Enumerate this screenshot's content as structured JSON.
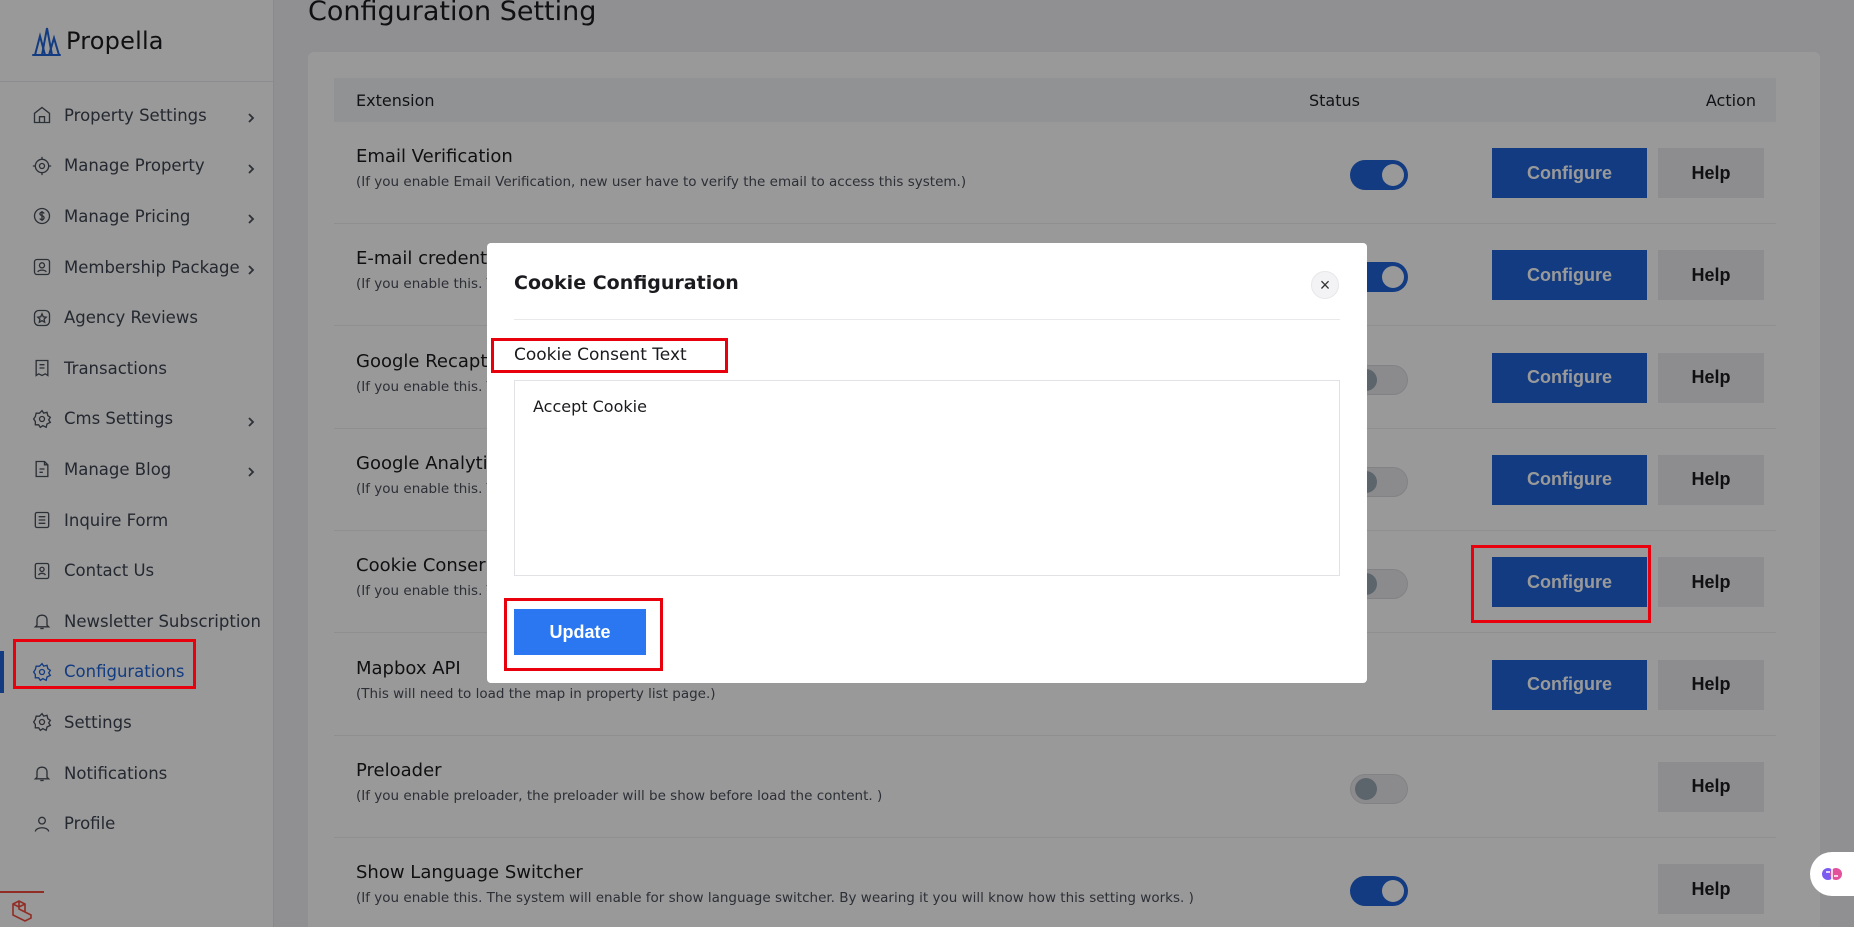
{
  "brand": {
    "name": "Propella"
  },
  "sidebar": {
    "items": [
      {
        "label": "Property Settings",
        "icon": "home-icon",
        "chevron": true
      },
      {
        "label": "Manage Property",
        "icon": "gear-badge-icon",
        "chevron": true
      },
      {
        "label": "Manage Pricing",
        "icon": "dollar-cycle-icon",
        "chevron": true
      },
      {
        "label": "Membership Package",
        "icon": "user-card-icon",
        "chevron": true
      },
      {
        "label": "Agency Reviews",
        "icon": "star-badge-icon",
        "chevron": false
      },
      {
        "label": "Transactions",
        "icon": "receipt-icon",
        "chevron": false
      },
      {
        "label": "Cms Settings",
        "icon": "gear-icon",
        "chevron": true
      },
      {
        "label": "Manage Blog",
        "icon": "edit-doc-icon",
        "chevron": true
      },
      {
        "label": "Inquire Form",
        "icon": "list-doc-icon",
        "chevron": false
      },
      {
        "label": "Contact Us",
        "icon": "contact-icon",
        "chevron": false
      },
      {
        "label": "Newsletter Subscription",
        "icon": "bell-icon",
        "chevron": false
      },
      {
        "label": "Configurations",
        "icon": "gears-icon",
        "chevron": false,
        "active": true
      },
      {
        "label": "Settings",
        "icon": "gear-icon",
        "chevron": false
      },
      {
        "label": "Notifications",
        "icon": "bell-icon",
        "chevron": false
      },
      {
        "label": "Profile",
        "icon": "user-icon",
        "chevron": false
      }
    ]
  },
  "main": {
    "title": "Configuration Setting",
    "table": {
      "headers": {
        "extension": "Extension",
        "status": "Status",
        "action": "Action"
      },
      "rows": [
        {
          "title": "Email Verification",
          "desc": "(If you enable Email Verification, new user have to verify the email to access this system.)",
          "toggle": "on",
          "configure": "Configure",
          "help": "Help"
        },
        {
          "title": "E-mail credent",
          "desc": "(If you enable this. T",
          "toggle": "on",
          "configure": "Configure",
          "help": "Help"
        },
        {
          "title": "Google Recapt",
          "desc": "(If you enable this. T",
          "toggle": "off",
          "configure": "Configure",
          "help": "Help"
        },
        {
          "title": "Google Analyti",
          "desc": "(If you enable this. T",
          "toggle": "off",
          "configure": "Configure",
          "help": "Help"
        },
        {
          "title": "Cookie Conser",
          "desc": "(If you enable this. T",
          "toggle": "off",
          "configure": "Configure",
          "help": "Help"
        },
        {
          "title": "Mapbox API",
          "desc": "(This will need to load the map in property list page.)",
          "toggle": "",
          "configure": "Configure",
          "help": "Help"
        },
        {
          "title": "Preloader",
          "desc": "(If you enable preloader, the preloader will be show before load the content. )",
          "toggle": "off",
          "configure": "",
          "help": "Help"
        },
        {
          "title": "Show Language Switcher",
          "desc": "(If you enable this. The system will enable for show language switcher. By wearing it you will know how this setting works. )",
          "toggle": "on",
          "configure": "",
          "help": "Help"
        }
      ]
    }
  },
  "modal": {
    "title": "Cookie Configuration",
    "close": "×",
    "field_label": "Cookie Consent Text",
    "field_value": "Accept Cookie",
    "update_label": "Update"
  },
  "colors": {
    "accent": "#1e63d8",
    "update": "#2a77f1",
    "highlight": "#e8000d"
  }
}
